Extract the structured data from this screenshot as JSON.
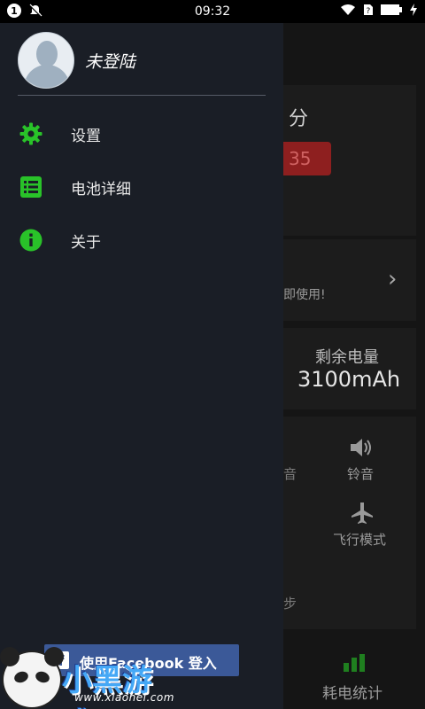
{
  "status_bar": {
    "time": "09:32",
    "notif_badge": "1"
  },
  "drawer": {
    "username": "未登陆",
    "menu": [
      {
        "label": "设置",
        "icon": "gear-icon"
      },
      {
        "label": "电池详细",
        "icon": "list-icon"
      },
      {
        "label": "关于",
        "icon": "info-icon"
      }
    ],
    "facebook_button": "使用Facebook 登入"
  },
  "background": {
    "unit_minutes": "分",
    "red_value": "35",
    "use_text_fragment": "即使用!",
    "remaining_title": "剩余电量",
    "remaining_value": "3100mAh",
    "sound_fragment": "音",
    "ringtone_label": "铃音",
    "airplane_label": "飞行模式",
    "bottom_fragment": "步",
    "bottom_tab": "耗电统计"
  },
  "watermark": {
    "text": "小黑游戏",
    "url": "www.xiaohei.com"
  },
  "colors": {
    "drawer_bg": "#1a1e26",
    "accent_green": "#29c229",
    "facebook_blue": "#3b5998",
    "status_bar": "#000000"
  }
}
